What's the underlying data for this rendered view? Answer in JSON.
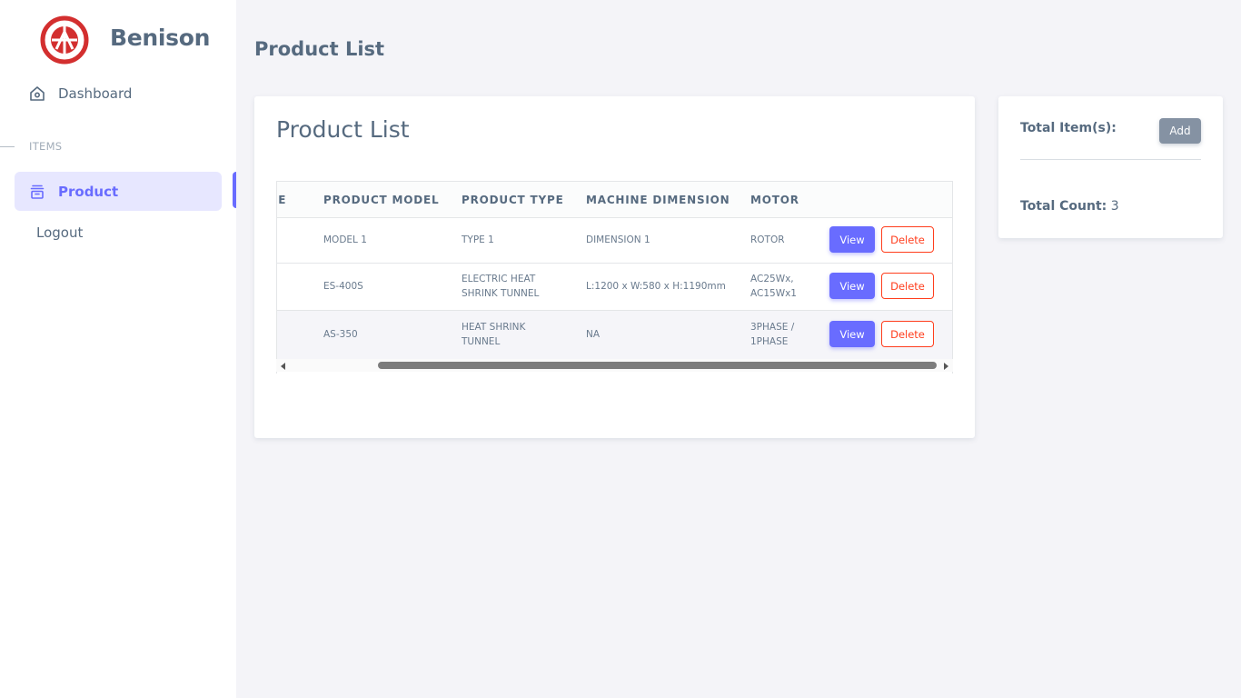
{
  "brand": {
    "name": "Benison",
    "logo_icon": "benison-logo-icon",
    "logo_color": "#d32f2f"
  },
  "sidebar": {
    "dashboard_label": "Dashboard",
    "section_label": "ITEMS",
    "product_label": "Product",
    "logout_label": "Logout",
    "active_color": "#696cff"
  },
  "page": {
    "title": "Product List"
  },
  "card": {
    "title": "Product List",
    "columns": [
      "IE",
      "PRODUCT MODEL",
      "PRODUCT TYPE",
      "MACHINE DIMENSION",
      "MOTOR"
    ],
    "rows": [
      {
        "model": "MODEL 1",
        "type_l1": "TYPE 1",
        "type_l2": "",
        "dimension": "DIMENSION 1",
        "motor_l1": "ROTOR",
        "motor_l2": ""
      },
      {
        "model": "ES-400S",
        "type_l1": "ELECTRIC HEAT",
        "type_l2": "SHRINK TUNNEL",
        "dimension": "L:1200 x W:580 x H:1190mm",
        "motor_l1": "AC25Wx,",
        "motor_l2": "AC15Wx1"
      },
      {
        "model": "AS-350",
        "type_l1": "HEAT SHRINK",
        "type_l2": "TUNNEL",
        "dimension": "NA",
        "motor_l1": "3PHASE /",
        "motor_l2": "1PHASE"
      }
    ],
    "view_label": "View",
    "delete_label": "Delete"
  },
  "summary": {
    "total_items_label": "Total Item(s):",
    "add_label": "Add",
    "total_count_label": "Total Count:",
    "total_count_value": "3"
  }
}
